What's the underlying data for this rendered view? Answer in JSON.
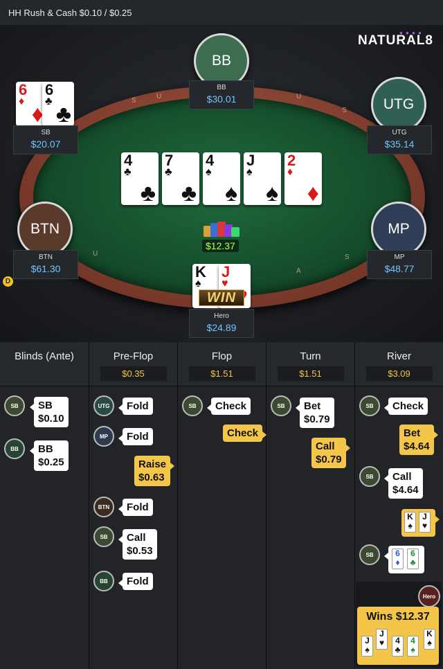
{
  "header": {
    "title": "HH  Rush & Cash $0.10 / $0.25"
  },
  "brand": {
    "logo": "NATURAL8"
  },
  "table": {
    "pot": "$12.37",
    "win_label": "WIN",
    "dealer": "D",
    "seats": {
      "bb": {
        "circle": "BB",
        "name": "BB",
        "stack": "$30.01"
      },
      "utg": {
        "circle": "UTG",
        "name": "UTG",
        "stack": "$35.14"
      },
      "sb": {
        "name": "SB",
        "stack": "$20.07",
        "cards": [
          {
            "rank": "6",
            "suit": "♦"
          },
          {
            "rank": "6",
            "suit": "♣"
          }
        ]
      },
      "btn": {
        "circle": "BTN",
        "name": "BTN",
        "stack": "$61.30"
      },
      "mp": {
        "circle": "MP",
        "name": "MP",
        "stack": "$48.77"
      },
      "hero": {
        "name": "Hero",
        "stack": "$24.89",
        "cards": [
          {
            "rank": "K",
            "suit": "♠"
          },
          {
            "rank": "J",
            "suit": "♥"
          }
        ]
      }
    },
    "board": [
      {
        "rank": "4",
        "suit": "♣"
      },
      {
        "rank": "7",
        "suit": "♣"
      },
      {
        "rank": "4",
        "suit": "♠"
      },
      {
        "rank": "J",
        "suit": "♠"
      },
      {
        "rank": "2",
        "suit": "♦"
      }
    ]
  },
  "history": {
    "columns": [
      {
        "title": "Blinds (Ante)",
        "pot": ""
      },
      {
        "title": "Pre-Flop",
        "pot": "$0.35"
      },
      {
        "title": "Flop",
        "pot": "$1.51"
      },
      {
        "title": "Turn",
        "pot": "$1.51"
      },
      {
        "title": "River",
        "pot": "$3.09"
      }
    ],
    "blinds": {
      "sb": {
        "badge": "SB",
        "line1": "SB",
        "line2": "$0.10"
      },
      "bb": {
        "badge": "BB",
        "line1": "BB",
        "line2": "$0.25"
      }
    },
    "preflop": {
      "utg": {
        "badge": "UTG",
        "action": "Fold"
      },
      "mp": {
        "badge": "MP",
        "action": "Fold"
      },
      "hero_raise": {
        "line1": "Raise",
        "line2": "$0.63"
      },
      "btn": {
        "badge": "BTN",
        "action": "Fold"
      },
      "sb": {
        "badge": "SB",
        "line1": "Call",
        "line2": "$0.53"
      },
      "bb": {
        "badge": "BB",
        "action": "Fold"
      }
    },
    "flop": {
      "sb": {
        "badge": "SB",
        "action": "Check"
      },
      "hero": {
        "action": "Check"
      }
    },
    "turn": {
      "sb": {
        "badge": "SB",
        "line1": "Bet",
        "line2": "$0.79"
      },
      "hero": {
        "line1": "Call",
        "line2": "$0.79"
      }
    },
    "river": {
      "sb1": {
        "badge": "SB",
        "action": "Check"
      },
      "hero_bet": {
        "line1": "Bet",
        "line2": "$4.64"
      },
      "sb2": {
        "badge": "SB",
        "line1": "Call",
        "line2": "$4.64"
      },
      "hero_show": [
        {
          "rank": "K",
          "suit": "♠"
        },
        {
          "rank": "J",
          "suit": "♥"
        }
      ],
      "sb_show": {
        "badge": "SB",
        "cards": [
          {
            "rank": "6",
            "suit": "♦"
          },
          {
            "rank": "6",
            "suit": "♣"
          }
        ]
      },
      "hero_badge": "Hero",
      "wins": "Wins $12.37",
      "win_cards": [
        {
          "rank": "J",
          "suit": "♠"
        },
        {
          "rank": "J",
          "suit": "♥"
        },
        {
          "rank": "4",
          "suit": "♣"
        },
        {
          "rank": "4",
          "suit": "♠"
        },
        {
          "rank": "K",
          "suit": "♠"
        }
      ]
    }
  },
  "colors": {
    "felt": "#1f6a3d",
    "rail": "#a65a46",
    "accent": "#f3c548",
    "stack": "#6fc7ff",
    "pot": "#b7ff5a"
  }
}
